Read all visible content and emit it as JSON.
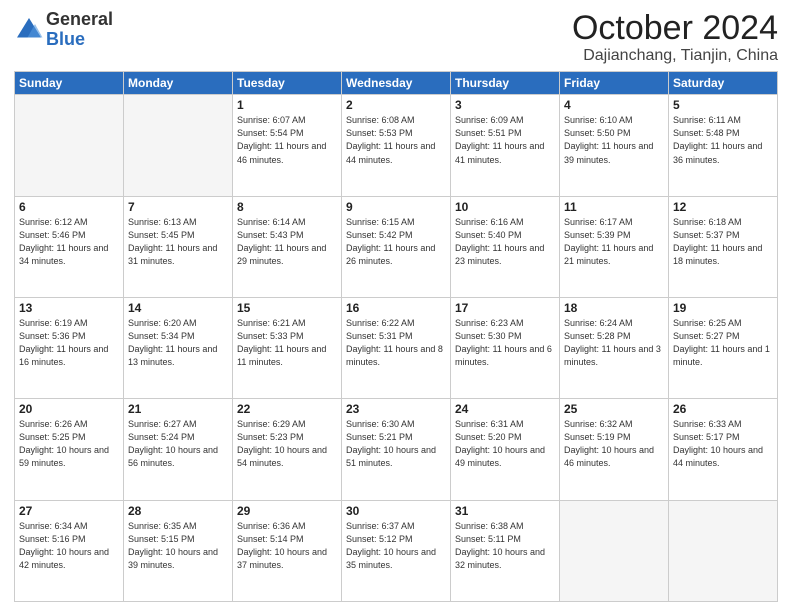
{
  "header": {
    "logo_general": "General",
    "logo_blue": "Blue",
    "month_title": "October 2024",
    "location": "Dajianchang, Tianjin, China"
  },
  "weekdays": [
    "Sunday",
    "Monday",
    "Tuesday",
    "Wednesday",
    "Thursday",
    "Friday",
    "Saturday"
  ],
  "weeks": [
    [
      {
        "day": "",
        "info": ""
      },
      {
        "day": "",
        "info": ""
      },
      {
        "day": "1",
        "info": "Sunrise: 6:07 AM\nSunset: 5:54 PM\nDaylight: 11 hours and 46 minutes."
      },
      {
        "day": "2",
        "info": "Sunrise: 6:08 AM\nSunset: 5:53 PM\nDaylight: 11 hours and 44 minutes."
      },
      {
        "day": "3",
        "info": "Sunrise: 6:09 AM\nSunset: 5:51 PM\nDaylight: 11 hours and 41 minutes."
      },
      {
        "day": "4",
        "info": "Sunrise: 6:10 AM\nSunset: 5:50 PM\nDaylight: 11 hours and 39 minutes."
      },
      {
        "day": "5",
        "info": "Sunrise: 6:11 AM\nSunset: 5:48 PM\nDaylight: 11 hours and 36 minutes."
      }
    ],
    [
      {
        "day": "6",
        "info": "Sunrise: 6:12 AM\nSunset: 5:46 PM\nDaylight: 11 hours and 34 minutes."
      },
      {
        "day": "7",
        "info": "Sunrise: 6:13 AM\nSunset: 5:45 PM\nDaylight: 11 hours and 31 minutes."
      },
      {
        "day": "8",
        "info": "Sunrise: 6:14 AM\nSunset: 5:43 PM\nDaylight: 11 hours and 29 minutes."
      },
      {
        "day": "9",
        "info": "Sunrise: 6:15 AM\nSunset: 5:42 PM\nDaylight: 11 hours and 26 minutes."
      },
      {
        "day": "10",
        "info": "Sunrise: 6:16 AM\nSunset: 5:40 PM\nDaylight: 11 hours and 23 minutes."
      },
      {
        "day": "11",
        "info": "Sunrise: 6:17 AM\nSunset: 5:39 PM\nDaylight: 11 hours and 21 minutes."
      },
      {
        "day": "12",
        "info": "Sunrise: 6:18 AM\nSunset: 5:37 PM\nDaylight: 11 hours and 18 minutes."
      }
    ],
    [
      {
        "day": "13",
        "info": "Sunrise: 6:19 AM\nSunset: 5:36 PM\nDaylight: 11 hours and 16 minutes."
      },
      {
        "day": "14",
        "info": "Sunrise: 6:20 AM\nSunset: 5:34 PM\nDaylight: 11 hours and 13 minutes."
      },
      {
        "day": "15",
        "info": "Sunrise: 6:21 AM\nSunset: 5:33 PM\nDaylight: 11 hours and 11 minutes."
      },
      {
        "day": "16",
        "info": "Sunrise: 6:22 AM\nSunset: 5:31 PM\nDaylight: 11 hours and 8 minutes."
      },
      {
        "day": "17",
        "info": "Sunrise: 6:23 AM\nSunset: 5:30 PM\nDaylight: 11 hours and 6 minutes."
      },
      {
        "day": "18",
        "info": "Sunrise: 6:24 AM\nSunset: 5:28 PM\nDaylight: 11 hours and 3 minutes."
      },
      {
        "day": "19",
        "info": "Sunrise: 6:25 AM\nSunset: 5:27 PM\nDaylight: 11 hours and 1 minute."
      }
    ],
    [
      {
        "day": "20",
        "info": "Sunrise: 6:26 AM\nSunset: 5:25 PM\nDaylight: 10 hours and 59 minutes."
      },
      {
        "day": "21",
        "info": "Sunrise: 6:27 AM\nSunset: 5:24 PM\nDaylight: 10 hours and 56 minutes."
      },
      {
        "day": "22",
        "info": "Sunrise: 6:29 AM\nSunset: 5:23 PM\nDaylight: 10 hours and 54 minutes."
      },
      {
        "day": "23",
        "info": "Sunrise: 6:30 AM\nSunset: 5:21 PM\nDaylight: 10 hours and 51 minutes."
      },
      {
        "day": "24",
        "info": "Sunrise: 6:31 AM\nSunset: 5:20 PM\nDaylight: 10 hours and 49 minutes."
      },
      {
        "day": "25",
        "info": "Sunrise: 6:32 AM\nSunset: 5:19 PM\nDaylight: 10 hours and 46 minutes."
      },
      {
        "day": "26",
        "info": "Sunrise: 6:33 AM\nSunset: 5:17 PM\nDaylight: 10 hours and 44 minutes."
      }
    ],
    [
      {
        "day": "27",
        "info": "Sunrise: 6:34 AM\nSunset: 5:16 PM\nDaylight: 10 hours and 42 minutes."
      },
      {
        "day": "28",
        "info": "Sunrise: 6:35 AM\nSunset: 5:15 PM\nDaylight: 10 hours and 39 minutes."
      },
      {
        "day": "29",
        "info": "Sunrise: 6:36 AM\nSunset: 5:14 PM\nDaylight: 10 hours and 37 minutes."
      },
      {
        "day": "30",
        "info": "Sunrise: 6:37 AM\nSunset: 5:12 PM\nDaylight: 10 hours and 35 minutes."
      },
      {
        "day": "31",
        "info": "Sunrise: 6:38 AM\nSunset: 5:11 PM\nDaylight: 10 hours and 32 minutes."
      },
      {
        "day": "",
        "info": ""
      },
      {
        "day": "",
        "info": ""
      }
    ]
  ]
}
